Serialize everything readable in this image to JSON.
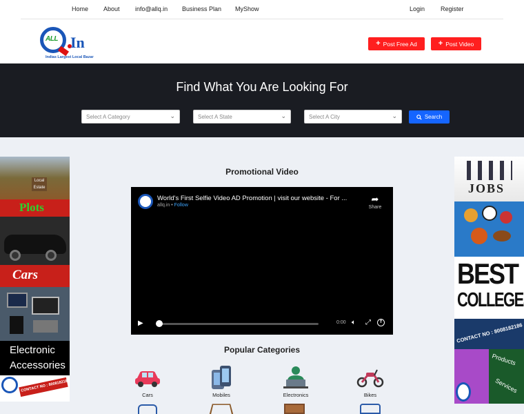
{
  "topnav": {
    "home": "Home",
    "about": "About",
    "email": "info@allq.in",
    "business_plan": "Business Plan",
    "myshow": "MyShow",
    "login": "Login",
    "register": "Register"
  },
  "header": {
    "logo": {
      "letters": "ALL",
      "in": "In",
      "tagline": "Indias Largest Local Bazar"
    },
    "post_free_ad": "Post Free Ad",
    "post_video": "Post Video"
  },
  "hero": {
    "title": "Find What You Are Looking For",
    "category_placeholder": "Select A Category",
    "state_placeholder": "Select A State",
    "city_placeholder": "Select A City",
    "search_label": "Search"
  },
  "promo": {
    "title": "Promotional Video",
    "video": {
      "title": "World's First Selfie Video AD Promotion | visit our website - For ...",
      "channel": "allq.in",
      "separator": "•",
      "follow": "Follow",
      "share": "Share",
      "time": "0:00"
    }
  },
  "categories": {
    "title": "Popular Categories",
    "items": [
      {
        "label": "Cars",
        "icon": "car-icon"
      },
      {
        "label": "Mobiles",
        "icon": "mobile-icon"
      },
      {
        "label": "Electronics",
        "icon": "electronics-icon"
      },
      {
        "label": "Bikes",
        "icon": "bike-icon"
      }
    ]
  },
  "left_ads": {
    "local_estate": "Local Estate",
    "plots": "Plots",
    "cars": "Cars",
    "electronic": "Electronic",
    "accessories": "Accessories",
    "contact": "CONTACT NO : 8008182186"
  },
  "right_ads": {
    "jobs": "JOBS",
    "best": "BEST",
    "colleges": "COLLEGES",
    "contact": "CONTACT NO : 8008182186",
    "products": "Products",
    "services": "Services"
  },
  "colors": {
    "brand_blue": "#1a56b8",
    "post_red": "#ff1f1f",
    "search_blue": "#1565ff",
    "hero_bg": "#1a1c22"
  }
}
